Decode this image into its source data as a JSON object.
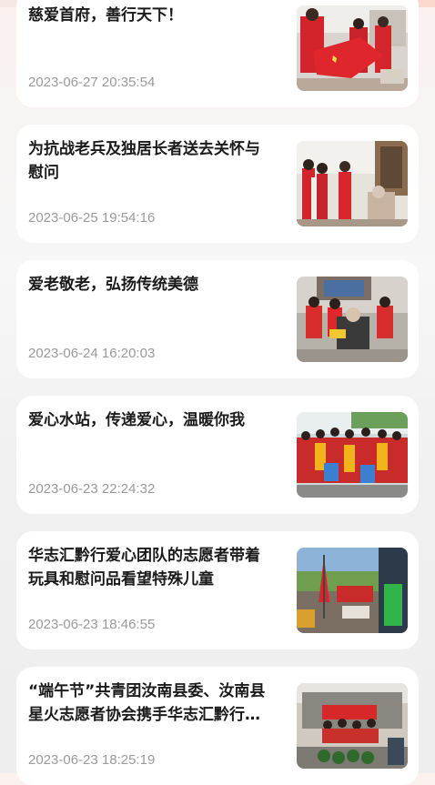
{
  "articles": [
    {
      "title": "慈爱首府，善行天下！",
      "date": "2023-06-27 20:35:54",
      "thumb": "volunteers-red-flag-photo"
    },
    {
      "title": "为抗战老兵及独居长者送去关怀与慰问",
      "date": "2023-06-25 19:54:16",
      "thumb": "volunteers-visiting-elder-photo"
    },
    {
      "title": "爱老敬老，弘扬传统美德",
      "date": "2023-06-24 16:20:03",
      "thumb": "group-with-elder-couple-photo"
    },
    {
      "title": "爱心水站，传递爱心，温暖你我",
      "date": "2023-06-23 22:24:32",
      "thumb": "water-station-crowd-photo"
    },
    {
      "title": "华志汇黔行爱心团队的志愿者带着玩具和慰问品看望特殊儿童",
      "date": "2023-06-23 18:46:55",
      "thumb": "outdoor-tent-flag-photo"
    },
    {
      "title": "“端午节”共青团汝南县委、汝南县星火志愿者协会携手华志汇黔行爱心团队开展活动",
      "date": "2023-06-23 18:25:19",
      "thumb": "watermelon-banner-photo"
    }
  ]
}
